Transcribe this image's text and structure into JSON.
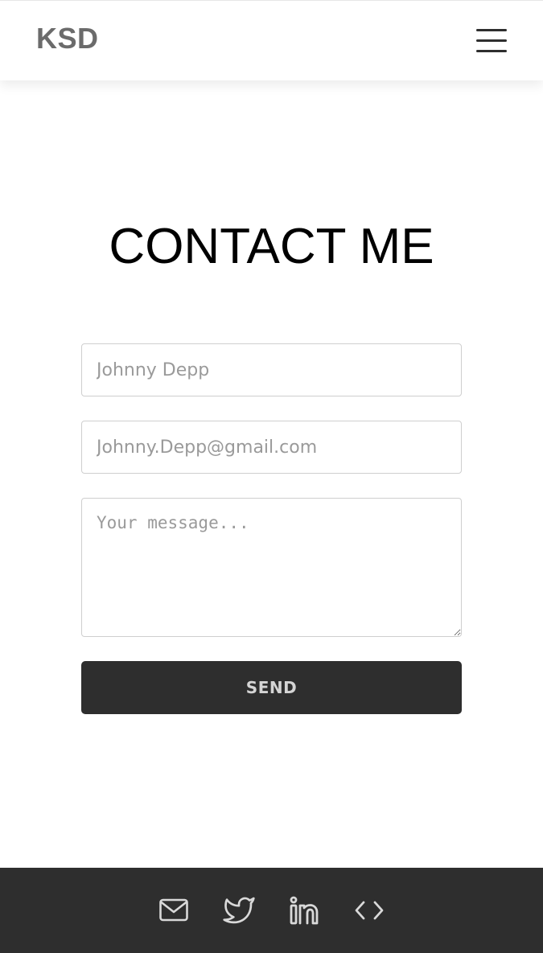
{
  "navbar": {
    "logo_text": "KSD",
    "menu_icon": "hamburger-menu-icon"
  },
  "main": {
    "title": "CONTACT ME",
    "form": {
      "name_placeholder": "Johnny Depp",
      "email_placeholder": "Johnny.Depp@gmail.com",
      "message_placeholder": "Your message...",
      "send_label": "SEND"
    }
  },
  "footer": {
    "icons": [
      "mail-icon",
      "twitter-icon",
      "linkedin-icon",
      "code-icon"
    ]
  },
  "colors": {
    "background": "#ffffff",
    "dark": "#2e2e2e",
    "logo": "#6b6b6b",
    "footer_icon": "#d9d9d9",
    "field_border": "#cfcfcf",
    "placeholder": "#9a9a9a"
  }
}
